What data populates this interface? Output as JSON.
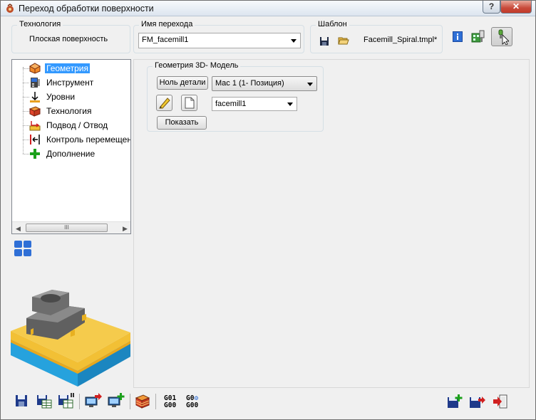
{
  "window": {
    "title": "Переход обработки поверхности",
    "help_label": "?",
    "close_label": "✕"
  },
  "technology": {
    "legend": "Технология",
    "value": "Плоская поверхность"
  },
  "step_name": {
    "legend": "Имя перехода",
    "value": "FM_facemill1"
  },
  "template": {
    "legend": "Шаблон",
    "value": "Facemill_Spiral.tmpl*"
  },
  "tree": {
    "items": [
      {
        "label": "Геометрия",
        "icon": "geometry-icon",
        "selected": true
      },
      {
        "label": "Инструмент",
        "icon": "tool-icon",
        "selected": false
      },
      {
        "label": "Уровни",
        "icon": "levels-icon",
        "selected": false
      },
      {
        "label": "Технология",
        "icon": "technology-icon",
        "selected": false
      },
      {
        "label": "Подвод / Отвод",
        "icon": "approach-retract-icon",
        "selected": false
      },
      {
        "label": "Контроль перемещен",
        "icon": "motion-control-icon",
        "selected": false
      },
      {
        "label": "Дополнение",
        "icon": "add-icon",
        "selected": false
      }
    ],
    "scroll_thumb": "III"
  },
  "geometry": {
    "legend": "Геометрия 3D- Модель",
    "zero_button": "Ноль детали",
    "mac_select": "Mac 1 (1- Позиция)",
    "model_select": "facemill1",
    "show_button": "Показать"
  },
  "bottom_toolbar": {
    "gcode_1": [
      "G01",
      "G00"
    ],
    "gcode_2": [
      "G0",
      "G00"
    ]
  }
}
